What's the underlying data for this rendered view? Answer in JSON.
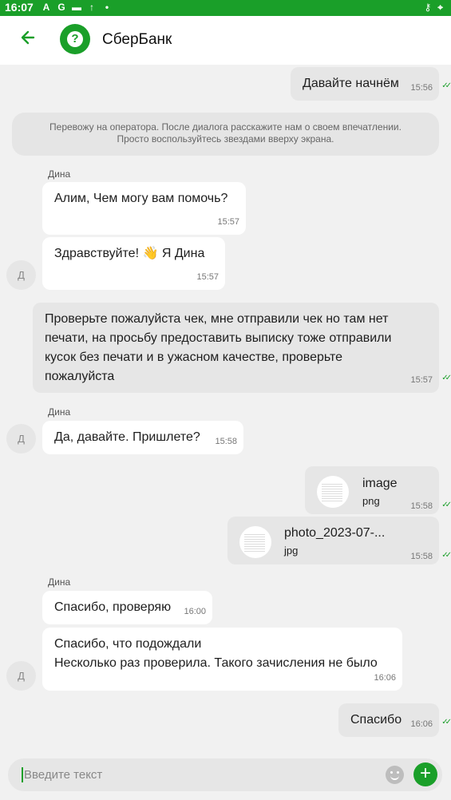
{
  "status_bar": {
    "time": "16:07",
    "icons": [
      "A",
      "G",
      "▬",
      "↑",
      "•"
    ],
    "right_icons": [
      "⚷",
      "⌖"
    ]
  },
  "header": {
    "title": "СберБанк",
    "logo_glyph": "?"
  },
  "messages": {
    "m1": {
      "text": "Давайте начнём",
      "time": "15:56"
    },
    "system": {
      "line1": "Перевожу на оператора. После диалога расскажите нам о своем впечатлении.",
      "line2": "Просто воспользуйтесь звездами вверху экрана."
    },
    "g1_sender": "Дина",
    "m2": {
      "text": "Алим, Чем могу вам помочь?",
      "time": "15:57"
    },
    "m3": {
      "text": "Здравствуйте! 👋 Я Дина",
      "time": "15:57"
    },
    "avatar_letter": "Д",
    "m4": {
      "line1": "Проверьте пожалуйста чек, мне отправили чек но там нет",
      "line2": "печати, на просьбу предоставить выписку тоже отправили",
      "line3": "кусок без печати и в ужасном качестве, проверьте",
      "line4": "пожалуйста",
      "time": "15:57"
    },
    "g2_sender": "Дина",
    "m5": {
      "text": "Да, давайте. Пришлете?",
      "time": "15:58"
    },
    "file1": {
      "name": "image",
      "ext": "png",
      "time": "15:58"
    },
    "file2": {
      "name": "photo_2023-07-...",
      "ext": "jpg",
      "time": "15:58"
    },
    "g3_sender": "Дина",
    "m6": {
      "text": "Спасибо, проверяю",
      "time": "16:00"
    },
    "m7": {
      "line1": "Спасибо, что подождали",
      "line2": "Несколько раз проверила. Такого зачисления не было",
      "time": "16:06"
    },
    "m8": {
      "text": "Спасибо",
      "time": "16:06"
    }
  },
  "input": {
    "placeholder": "Введите текст"
  },
  "colors": {
    "accent": "#1a9f29",
    "incoming": "#ffffff",
    "outgoing": "#e6e6e6",
    "background": "#f1f1f1"
  }
}
